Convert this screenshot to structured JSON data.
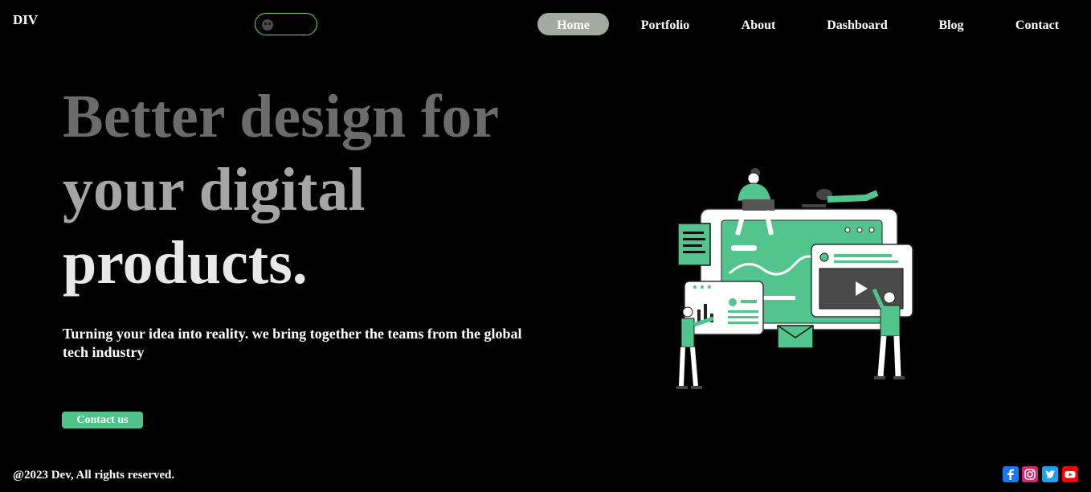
{
  "header": {
    "logo": "DIV",
    "nav": [
      {
        "label": "Home",
        "active": true
      },
      {
        "label": "Portfolio",
        "active": false
      },
      {
        "label": "About",
        "active": false
      },
      {
        "label": "Dashboard",
        "active": false
      },
      {
        "label": "Blog",
        "active": false
      },
      {
        "label": "Contact",
        "active": false
      }
    ]
  },
  "hero": {
    "title_lines": [
      "Better design for",
      "your digital",
      "products."
    ],
    "subtitle": "Turning your idea into reality. we bring together the teams from the global tech industry",
    "cta_label": "Contact us"
  },
  "footer": {
    "copyright": "@2023 Dev, All rights reserved.",
    "social": [
      {
        "icon": "facebook-icon",
        "color": "#1877f2"
      },
      {
        "icon": "instagram-icon",
        "color": "#e1306c"
      },
      {
        "icon": "twitter-icon",
        "color": "#1da1f2"
      },
      {
        "icon": "youtube-icon",
        "color": "#ff0000"
      }
    ]
  },
  "colors": {
    "background": "#000000",
    "accent": "#4fc38a",
    "active_nav": "#a3aaa0",
    "toggle_border": "#8bd646"
  }
}
